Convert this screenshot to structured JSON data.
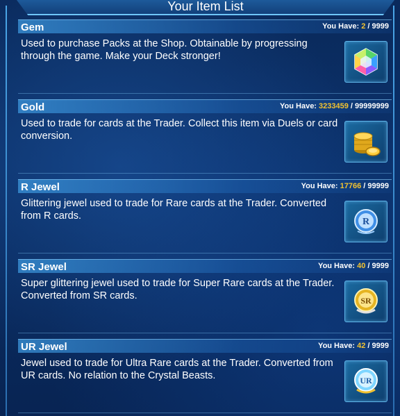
{
  "header": {
    "title": "Your Item List"
  },
  "labels": {
    "you_have": "You Have:"
  },
  "items": [
    {
      "name": "Gem",
      "current": "2",
      "max": "9999",
      "description": "Used to purchase Packs at the Shop. Obtainable by progressing through the game. Make your Deck stronger!",
      "icon": "gem-icon"
    },
    {
      "name": "Gold",
      "current": "3233459",
      "max": "99999999",
      "description": "Used to trade for cards at the Trader. Collect this item via Duels or card conversion.",
      "icon": "gold-coins-icon"
    },
    {
      "name": "R Jewel",
      "current": "17766",
      "max": "99999",
      "description": "Glittering jewel used to trade for Rare cards at the Trader. Converted from R cards.",
      "icon": "r-jewel-icon",
      "icon_text": "R"
    },
    {
      "name": "SR Jewel",
      "current": "40",
      "max": "9999",
      "description": "Super glittering jewel used to trade for Super Rare cards at the Trader. Converted from SR cards.",
      "icon": "sr-jewel-icon",
      "icon_text": "SR"
    },
    {
      "name": "UR Jewel",
      "current": "42",
      "max": "9999",
      "description": "Jewel used to trade for Ultra Rare cards at the Trader. Converted from UR cards. No relation to the Crystal Beasts.",
      "icon": "ur-jewel-icon",
      "icon_text": "UR"
    }
  ]
}
